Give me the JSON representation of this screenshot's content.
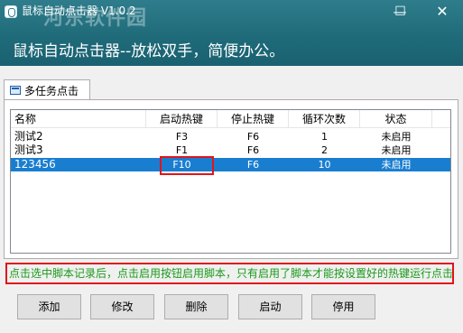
{
  "window": {
    "title": "鼠标自动点击器 V1.0.2",
    "watermark": "河东软件园",
    "slogan": "鼠标自动点击器--放松双手，简便办公。",
    "min_glyph": "—",
    "max_glyph": "☐",
    "close_glyph": "✕"
  },
  "tabs": [
    {
      "label": "多任务点击"
    }
  ],
  "table": {
    "columns": [
      "名称",
      "启动热键",
      "停止热键",
      "循环次数",
      "状态"
    ],
    "rows": [
      {
        "name": "测试2",
        "start_key": "F3",
        "stop_key": "F6",
        "loops": "1",
        "status": "未启用",
        "selected": false
      },
      {
        "name": "测试3",
        "start_key": "F1",
        "stop_key": "F6",
        "loops": "2",
        "status": "未启用",
        "selected": false
      },
      {
        "name": "123456",
        "start_key": "F10",
        "stop_key": "F6",
        "loops": "10",
        "status": "未启用",
        "selected": true
      }
    ]
  },
  "hint_text": "点击选中脚本记录后，点击启用按钮启用脚本，只有启用了脚本才能按设置好的热键运行点击",
  "buttons": {
    "add": "添加",
    "edit": "修改",
    "delete": "删除",
    "start": "启动",
    "disable": "停用"
  },
  "colors": {
    "titlebar": "#1f6b7a",
    "selection": "#1a7ed0",
    "highlight_border": "#e0151b",
    "hint_text": "#1a9a1a"
  }
}
